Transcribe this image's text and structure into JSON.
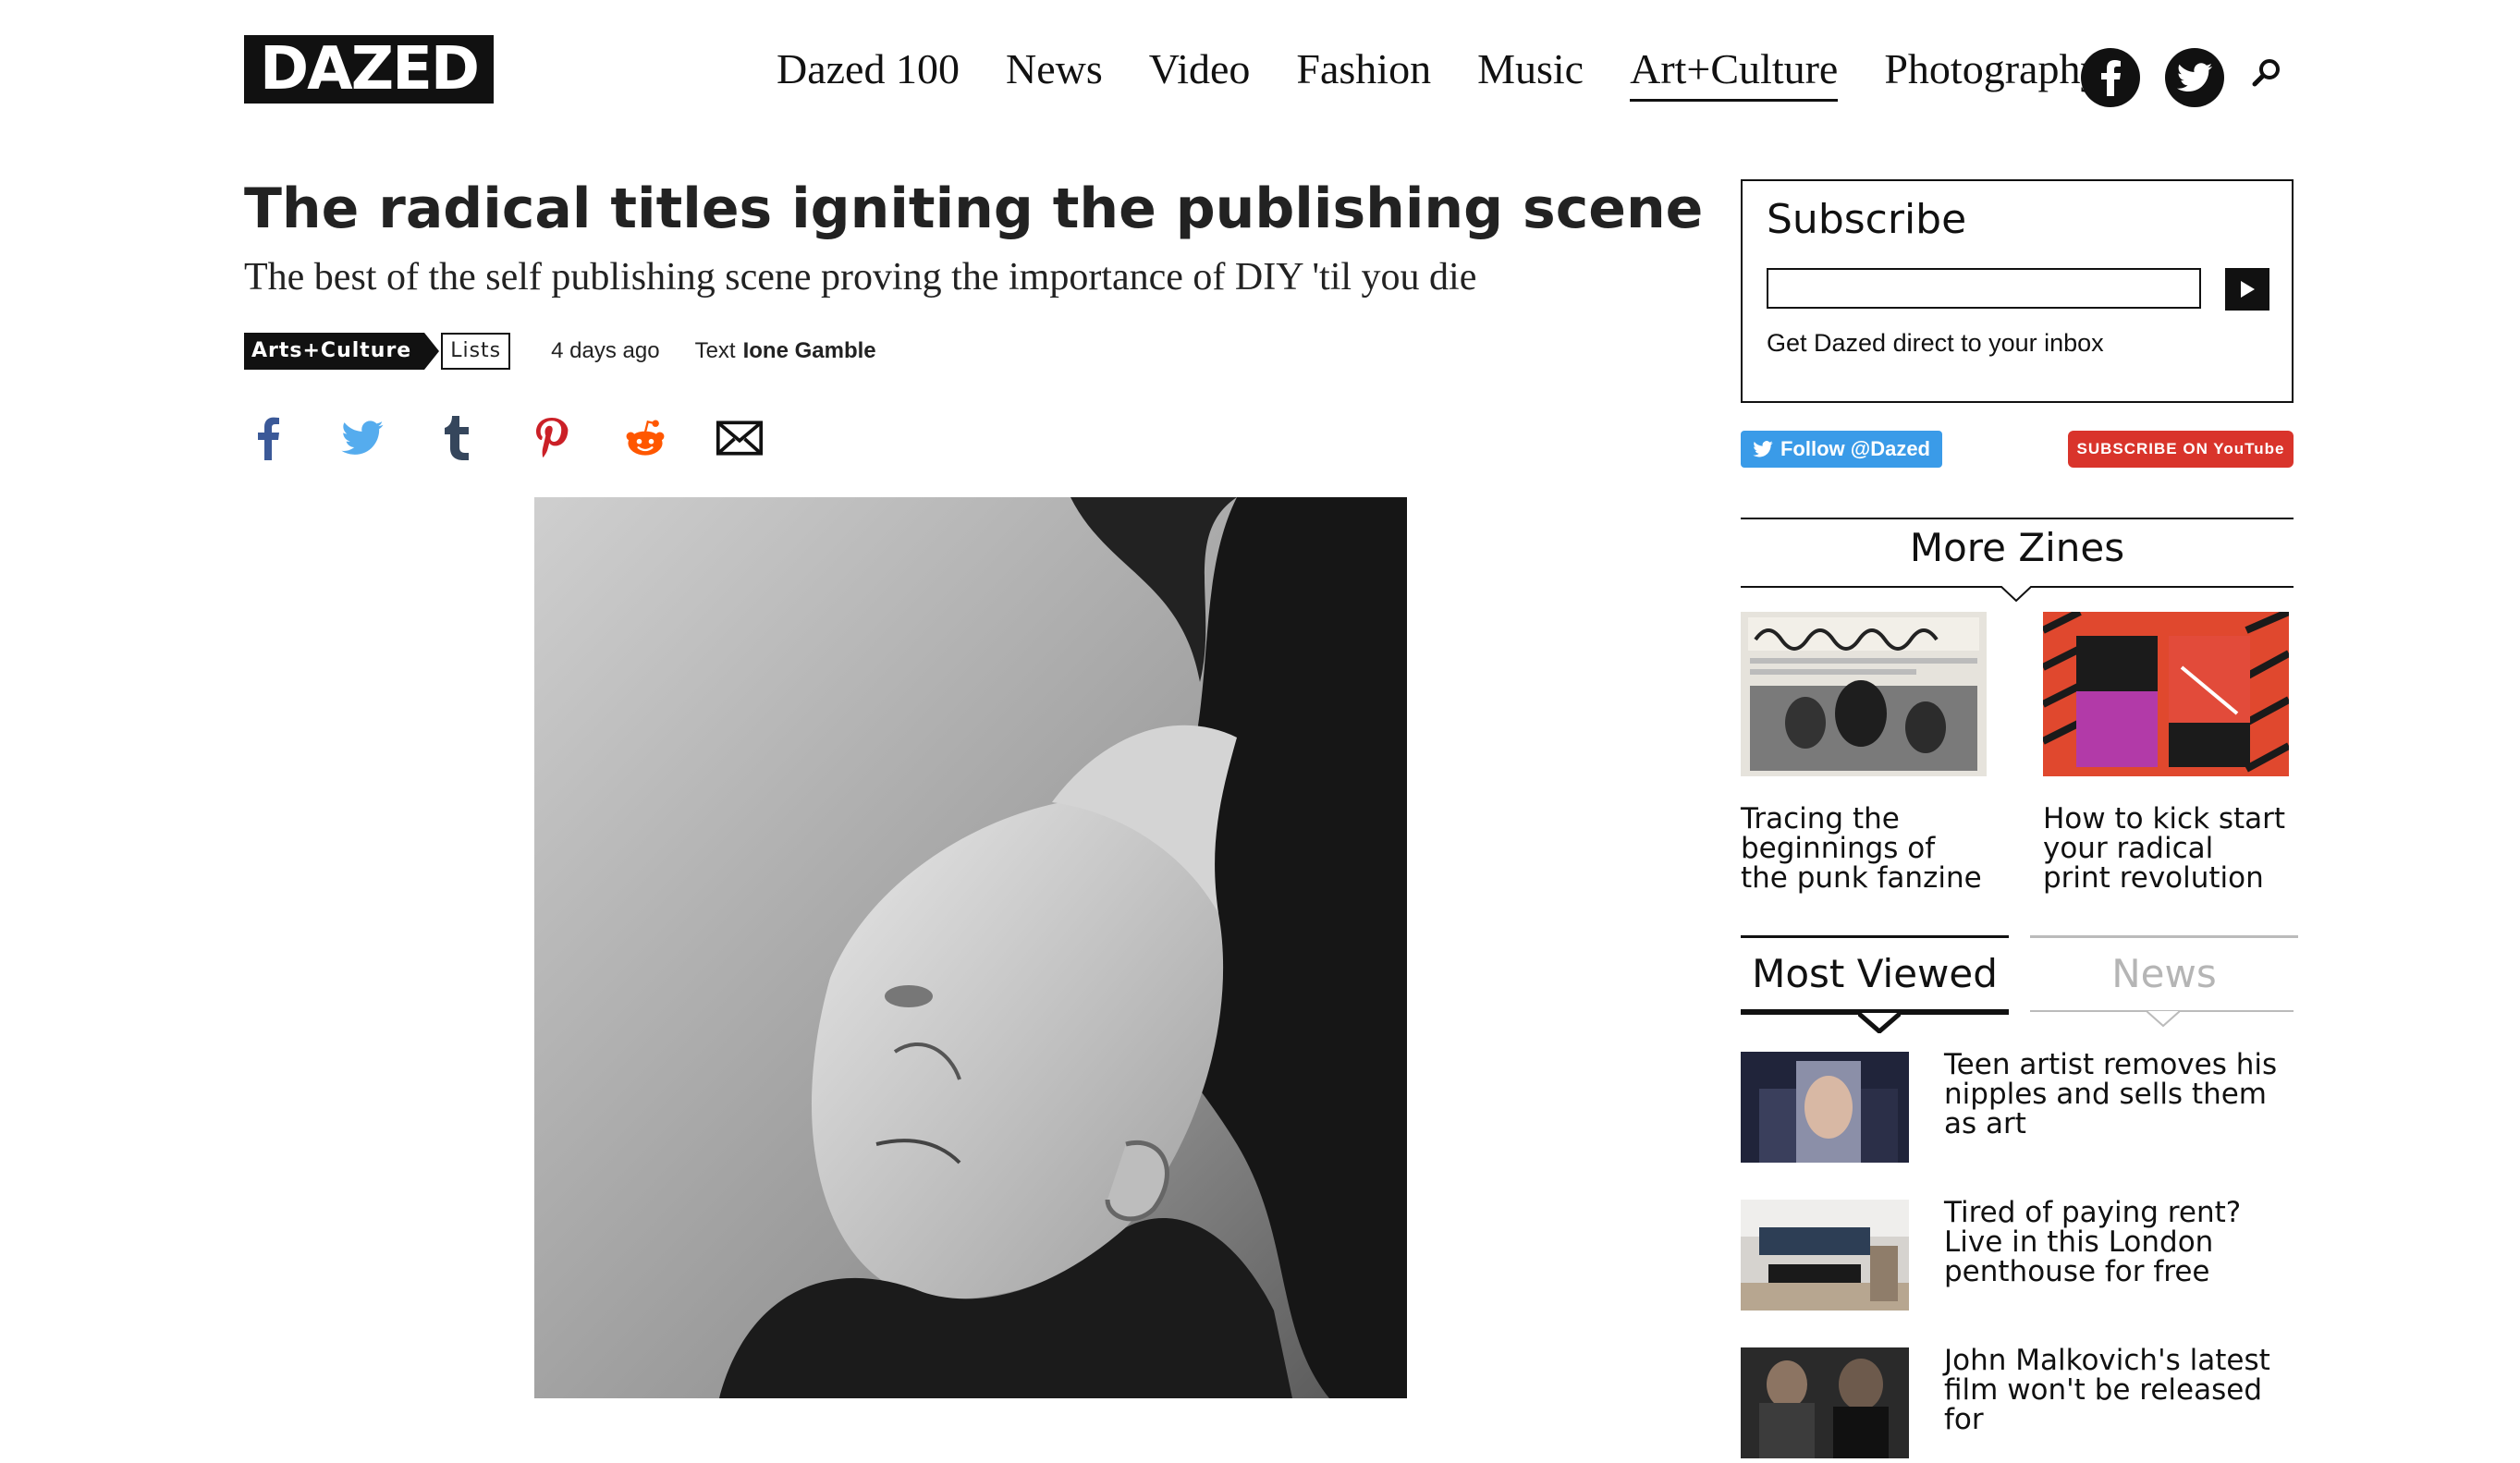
{
  "header": {
    "logo": "DAZED",
    "nav": [
      {
        "label": "Dazed 100",
        "active": false
      },
      {
        "label": "News",
        "active": false
      },
      {
        "label": "Video",
        "active": false
      },
      {
        "label": "Fashion",
        "active": false
      },
      {
        "label": "Music",
        "active": false
      },
      {
        "label": "Art+Culture",
        "active": true
      },
      {
        "label": "Photography",
        "active": false
      }
    ],
    "social": [
      "facebook-icon",
      "twitter-icon",
      "search-icon"
    ]
  },
  "article": {
    "title": "The radical titles igniting the publishing scene",
    "standfirst": "The best of the self publishing scene proving the importance of DIY 'til you die",
    "section_tag": "Arts+Culture",
    "type_tag": "Lists",
    "date": "4 days ago",
    "author_prefix": "Text",
    "author": "Ione Gamble",
    "share_icons": [
      "facebook-icon",
      "twitter-icon",
      "tumblr-icon",
      "pinterest-icon",
      "reddit-icon",
      "email-icon"
    ]
  },
  "sidebar": {
    "subscribe": {
      "title": "Subscribe",
      "input_value": "",
      "note": "Get Dazed direct to your inbox"
    },
    "follow_label": "Follow @Dazed",
    "youtube_label": "SUBSCRIBE ON YouTube",
    "more_zines": {
      "title": "More Zines",
      "items": [
        {
          "title": "Tracing the beginnings of the punk fanzine"
        },
        {
          "title": "How to kick start your radical print revolution"
        }
      ]
    },
    "tabs": {
      "most_viewed": "Most Viewed",
      "news": "News"
    },
    "most_viewed": [
      {
        "title": "Teen artist removes his nipples and sells them as art"
      },
      {
        "title": "Tired of paying rent? Live in this London penthouse for free"
      },
      {
        "title": "John Malkovich's latest film won't be released for"
      }
    ]
  },
  "colors": {
    "text": "#111111",
    "twitter": "#3a9be8",
    "youtube": "#d9342b",
    "facebook_share": "#3b5998",
    "twitter_share": "#55acee",
    "tumblr_share": "#35465c",
    "pinterest_share": "#cb2027",
    "reddit_share": "#ff5700"
  }
}
